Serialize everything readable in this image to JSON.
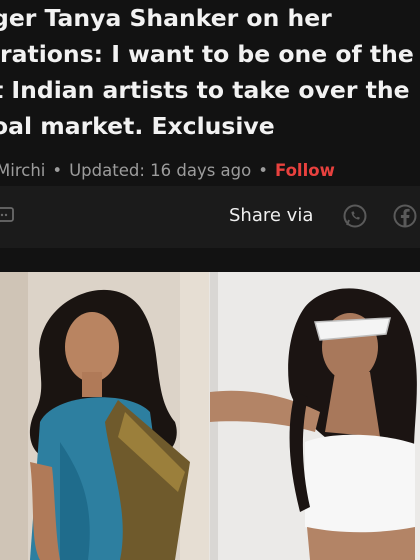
{
  "article": {
    "headline_lines": [
      "ger Tanya Shanker on her",
      "irations: I want to be one of the",
      "t Indian artists to take over the",
      "oal market. Exclusive"
    ],
    "source": "Mirchi",
    "separator": "•",
    "updated": "Updated: 16 days ago",
    "follow_label": "Follow"
  },
  "share": {
    "label": "Share via"
  },
  "icons": {
    "left": "comment-icon",
    "whatsapp": "whatsapp-icon",
    "facebook": "facebook-icon"
  },
  "colors": {
    "background": "#121212",
    "share_bar": "#1b1b1b",
    "follow": "#e8413e",
    "meta_text": "#9c9c9c"
  }
}
